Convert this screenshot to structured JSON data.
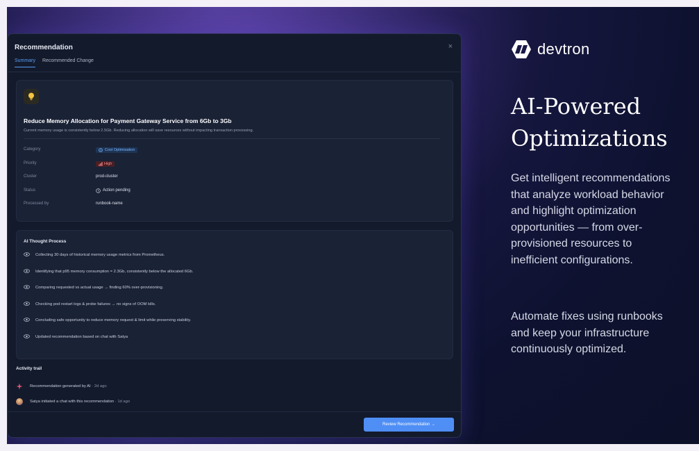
{
  "modal": {
    "title": "Recommendation",
    "close_glyph": "×",
    "tabs": [
      {
        "label": "Summary",
        "active": true
      },
      {
        "label": "Recommended Change",
        "active": false
      }
    ],
    "summary": {
      "icon": "lightbulb-icon",
      "headline": "Reduce Memory Allocation for Payment Gateway Service from 6Gb to 3Gb",
      "subline": "Current memory usage is consistently below 2.5Gb. Reducing allocation will save resources without impacting transaction processing.",
      "meta": [
        {
          "key": "Category",
          "value": "Cost Optimisation",
          "type": "category"
        },
        {
          "key": "Priority",
          "value": "High",
          "type": "priority"
        },
        {
          "key": "Cluster",
          "value": "prod-cluster",
          "type": "text"
        },
        {
          "key": "Status",
          "value": "Action pending",
          "type": "status"
        },
        {
          "key": "Processed by",
          "value": "runbook-name",
          "type": "text"
        }
      ]
    },
    "thought_process": {
      "title": "AI Thought Process",
      "items": [
        "Collecting 30 days of historical memory usage metrics from Prometheus.",
        "Identifying that p95 memory consumption = 2.3Gb, consistently below the allocated 6Gb.",
        "Comparing requested vs actual usage → finding 60% over-provisioning.",
        "Checking pod restart logs & probe failures → no signs of OOM kills.",
        "Concluding safe opportunity to reduce memory request & limit while preserving stability.",
        "Updated recommendation based on chat with Satya"
      ]
    },
    "activity": {
      "title": "Activity trail",
      "items": [
        {
          "text": "Recommendation generated by AI",
          "time": "· 2d ago",
          "icon": "sparkle-icon"
        },
        {
          "text": "Satya initiated a chat with this recommendation",
          "time": "· 1d ago",
          "icon": "avatar"
        }
      ]
    },
    "review_button": "Review Recommendation →"
  },
  "brand": {
    "name": "devtron",
    "logo": "devtron-logo-icon"
  },
  "hero": {
    "title_line1": "AI-Powered",
    "title_line2": "Optimizations",
    "body_lines": [
      "Get intelligent recommendations",
      "that analyze workload behavior",
      "and highlight optimization",
      "opportunities — from over-",
      "provisioned resources to",
      "inefficient configurations."
    ],
    "body2_lines": [
      "Automate fixes using runbooks",
      "and keep your infrastructure",
      "continuously optimized."
    ]
  },
  "colors": {
    "accent": "#4f8ef5",
    "priority": "#ff8d8d",
    "background": "#0e1230"
  }
}
